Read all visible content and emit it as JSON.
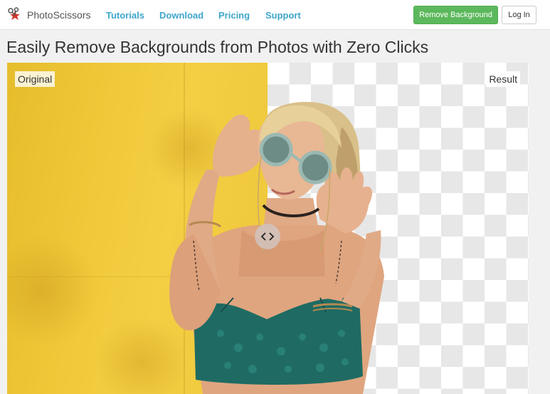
{
  "brand": {
    "name": "PhotoScissors",
    "logo_icon": "scissors-star-logo-icon"
  },
  "nav": {
    "links": [
      {
        "label": "Tutorials"
      },
      {
        "label": "Download"
      },
      {
        "label": "Pricing"
      },
      {
        "label": "Support"
      }
    ],
    "remove_background_label": "Remove Background",
    "login_label": "Log In"
  },
  "headline": "Easily Remove Backgrounds from Photos with Zero Clicks",
  "compare": {
    "original_label": "Original",
    "result_label": "Result",
    "slider_icon": "chevron-left-right-icon"
  },
  "colors": {
    "link": "#3ea6cc",
    "primary_button": "#5cb85c",
    "original_background": "#f0c93a",
    "checker": "#e7e7e7"
  }
}
